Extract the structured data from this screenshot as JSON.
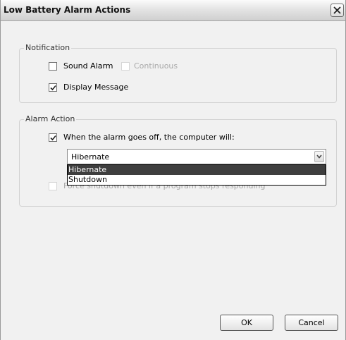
{
  "window": {
    "title": "Low Battery Alarm Actions"
  },
  "notification": {
    "title": "Notification",
    "sound_alarm": {
      "label": "Sound Alarm",
      "checked": false
    },
    "continuous": {
      "label": "Continuous",
      "checked": false,
      "enabled": false
    },
    "display_message": {
      "label": "Display Message",
      "checked": true
    }
  },
  "alarm_action": {
    "title": "Alarm Action",
    "run_action": {
      "label": "When the alarm goes off, the computer will:",
      "checked": true
    },
    "action_select": {
      "value": "Hibernate",
      "options": [
        "Hibernate",
        "Shutdown"
      ],
      "highlighted": "Hibernate"
    },
    "force_shutdown": {
      "label": "Force shutdown even if a program stops responding",
      "checked": false,
      "enabled": false
    }
  },
  "buttons": {
    "ok": "OK",
    "cancel": "Cancel"
  },
  "icons": {
    "close": "close-icon",
    "check": "checkmark-icon",
    "dropdown": "chevron-down-icon"
  }
}
